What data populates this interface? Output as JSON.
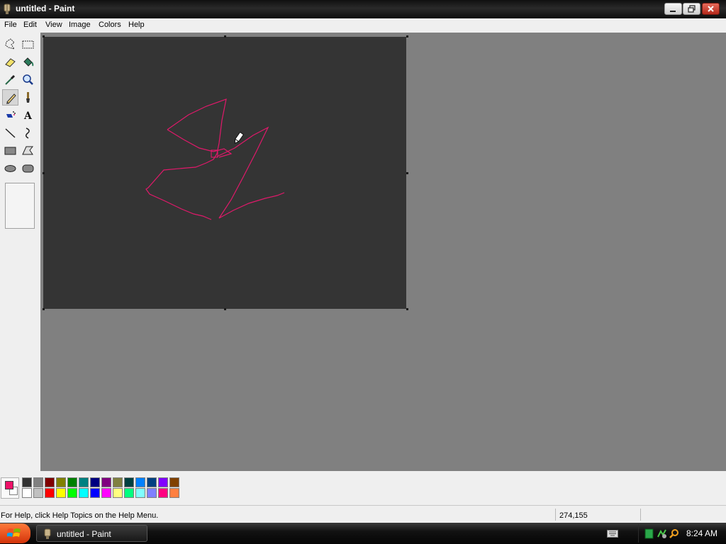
{
  "window": {
    "title": "untitled - Paint"
  },
  "menu": {
    "items": [
      "File",
      "Edit",
      "View",
      "Image",
      "Colors",
      "Help"
    ]
  },
  "toolbox": {
    "tools": [
      {
        "name": "free-form-select",
        "icon": "free-form-select-icon"
      },
      {
        "name": "select",
        "icon": "rectangle-select-icon"
      },
      {
        "name": "eraser",
        "icon": "eraser-icon"
      },
      {
        "name": "fill-with-color",
        "icon": "paint-bucket-icon"
      },
      {
        "name": "pick-color",
        "icon": "eyedropper-icon"
      },
      {
        "name": "magnifier",
        "icon": "magnifier-icon"
      },
      {
        "name": "pencil",
        "icon": "pencil-icon",
        "selected": true
      },
      {
        "name": "brush",
        "icon": "brush-icon"
      },
      {
        "name": "airbrush",
        "icon": "airbrush-icon"
      },
      {
        "name": "text",
        "icon": "text-icon",
        "label": "A"
      },
      {
        "name": "line",
        "icon": "line-icon"
      },
      {
        "name": "curve",
        "icon": "curve-icon"
      },
      {
        "name": "rectangle",
        "icon": "rectangle-icon"
      },
      {
        "name": "polygon",
        "icon": "polygon-icon"
      },
      {
        "name": "ellipse",
        "icon": "ellipse-icon"
      },
      {
        "name": "rounded-rectangle",
        "icon": "rounded-rectangle-icon"
      }
    ]
  },
  "canvas": {
    "background_color": "#343434",
    "stroke_color": "#e0196a"
  },
  "palette": {
    "foreground": "#ee1168",
    "background": "#ffffff",
    "colors_top": [
      "#323232",
      "#808080",
      "#800000",
      "#808000",
      "#008000",
      "#008080",
      "#000080",
      "#800080",
      "#808040",
      "#004040",
      "#0080ff",
      "#004080",
      "#8000ff",
      "#804000"
    ],
    "colors_bottom": [
      "#ffffff",
      "#c0c0c0",
      "#ff0000",
      "#ffff00",
      "#00ff00",
      "#00ffff",
      "#0000ff",
      "#ff00ff",
      "#ffff80",
      "#00ff80",
      "#80ffff",
      "#8080ff",
      "#ff0080",
      "#ff8040"
    ]
  },
  "status": {
    "help_text": "For Help, click Help Topics on the Help Menu.",
    "coordinates": "274,155"
  },
  "taskbar": {
    "task_label": "untitled - Paint",
    "clock": "8:24 AM"
  }
}
